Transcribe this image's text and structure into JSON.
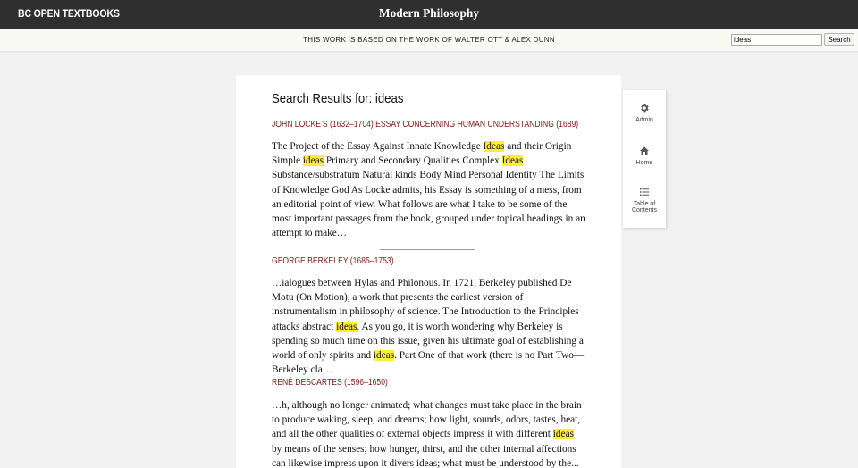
{
  "header": {
    "brand": "BC OPEN TEXTBOOKS",
    "book_title": "Modern Philosophy"
  },
  "subheader": {
    "credit": "THIS WORK IS BASED ON THE WORK OF WALTER OTT & ALEX DUNN",
    "search": {
      "value": "ideas",
      "button_label": "Search"
    }
  },
  "main": {
    "heading": "Search Results for: ideas",
    "results": [
      {
        "title": "JOHN LOCKE’S (1632–1704) ESSAY CONCERNING HUMAN UNDERSTANDING (1689)",
        "excerpt": [
          {
            "t": "The Project of the Essay Against Innate Knowledge "
          },
          {
            "t": "Ideas",
            "hl": true
          },
          {
            "t": " and their Origin Simple "
          },
          {
            "t": "ideas",
            "hl": true
          },
          {
            "t": " Primary and Secondary Qualities Complex "
          },
          {
            "t": "Ideas",
            "hl": true
          },
          {
            "t": " Substance/substratum Natural kinds Body Mind Personal Identity The Limits of Knowledge God As Locke admits, his Essay is something of a mess, from an editorial point of view. What follows are what I take to be some of the most important passages from the book, grouped under topical headings in an attempt to make…"
          }
        ]
      },
      {
        "title": "GEORGE BERKELEY (1685–1753)",
        "excerpt": [
          {
            "t": "…ialogues between Hylas and Philonous. In 1721, Berkeley published De Motu (On Motion), a work that presents the earliest version of instrumentalism in philosophy of science. The Introduction to the Principles attacks abstract "
          },
          {
            "t": "ideas",
            "hl": true
          },
          {
            "t": ". As you go, it is worth wondering why Berkeley is spending so much time on this issue, given his ultimate goal of establishing a world of only spirits and "
          },
          {
            "t": "ideas",
            "hl": true
          },
          {
            "t": ". Part One of that work (there is no Part Two—Berkeley cla…"
          }
        ]
      },
      {
        "title": "RENÉ DESCARTES (1596–1650)",
        "excerpt": [
          {
            "t": "…h, although no longer animated; what changes must take place in the brain to produce waking, sleep, and dreams; how light, sounds, odors, tastes, heat, and all the other qualities of external objects impress it with different "
          },
          {
            "t": "ideas",
            "hl": true
          },
          {
            "t": " by means of the senses; how hunger, thirst, and the other internal affections can likewise impress upon it divers ideas; what must be understood by the..."
          }
        ]
      }
    ]
  },
  "sidenav": {
    "items": [
      {
        "label": "Admin",
        "icon": "gear-icon"
      },
      {
        "label": "Home",
        "icon": "home-icon"
      },
      {
        "label": "Table of Contents",
        "icon": "list-icon"
      }
    ]
  },
  "colors": {
    "topbar": "#2f2f2f",
    "result_title": "#7a1d16",
    "highlight": "#fbed3c"
  }
}
